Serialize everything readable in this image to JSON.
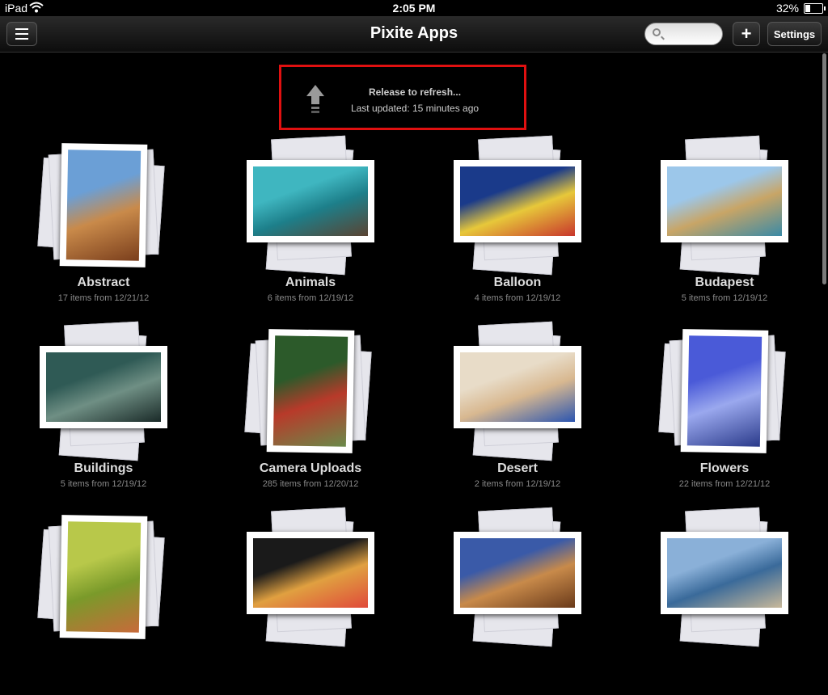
{
  "status_bar": {
    "device": "iPad",
    "time": "2:05 PM",
    "battery": "32%",
    "battery_level": 0.32
  },
  "nav": {
    "title": "Pixite Apps",
    "search_placeholder": "",
    "add_label": "+",
    "settings_label": "Settings"
  },
  "refresh": {
    "title": "Release to refresh...",
    "subtitle": "Last updated: 15 minutes ago"
  },
  "albums": [
    {
      "name": "Abstract",
      "meta": "17 items from 12/21/12",
      "layout": "portrait",
      "colors": [
        "#6b9fd6",
        "#c98a4a",
        "#7a3e1c"
      ]
    },
    {
      "name": "Animals",
      "meta": "6 items from 12/19/12",
      "layout": "landscape",
      "colors": [
        "#3fb6c0",
        "#1d7f8a",
        "#5a4332"
      ]
    },
    {
      "name": "Balloon",
      "meta": "4 items from 12/19/12",
      "layout": "landscape",
      "colors": [
        "#1a3a8a",
        "#e7c83a",
        "#c8362c"
      ]
    },
    {
      "name": "Budapest",
      "meta": "5 items from 12/19/12",
      "layout": "landscape",
      "colors": [
        "#9cc7ea",
        "#c8a566",
        "#3a8aa6"
      ]
    },
    {
      "name": "Buildings",
      "meta": "5 items from 12/19/12",
      "layout": "landscape",
      "colors": [
        "#2f5a55",
        "#6f8f84",
        "#1a2a28"
      ]
    },
    {
      "name": "Camera Uploads",
      "meta": "285 items from 12/20/12",
      "layout": "portrait",
      "colors": [
        "#2c5a2a",
        "#b83a2a",
        "#6a8a4a"
      ]
    },
    {
      "name": "Desert",
      "meta": "2 items from 12/19/12",
      "layout": "landscape",
      "colors": [
        "#e8dcc8",
        "#d8b890",
        "#2b55b0"
      ]
    },
    {
      "name": "Flowers",
      "meta": "22 items from 12/21/12",
      "layout": "portrait",
      "colors": [
        "#4a5ad8",
        "#9aa8ee",
        "#2a3a8a"
      ]
    },
    {
      "name": "",
      "meta": "",
      "layout": "portrait",
      "colors": [
        "#b8c84a",
        "#7a9a2a",
        "#c86a3a"
      ]
    },
    {
      "name": "",
      "meta": "",
      "layout": "landscape",
      "colors": [
        "#1a1a1a",
        "#e0a040",
        "#e04a3a"
      ]
    },
    {
      "name": "",
      "meta": "",
      "layout": "landscape",
      "colors": [
        "#3a5aa8",
        "#c88a4a",
        "#6a3a1a"
      ]
    },
    {
      "name": "",
      "meta": "",
      "layout": "landscape",
      "colors": [
        "#8ab0d8",
        "#3a6a9a",
        "#c8b89a"
      ]
    }
  ]
}
